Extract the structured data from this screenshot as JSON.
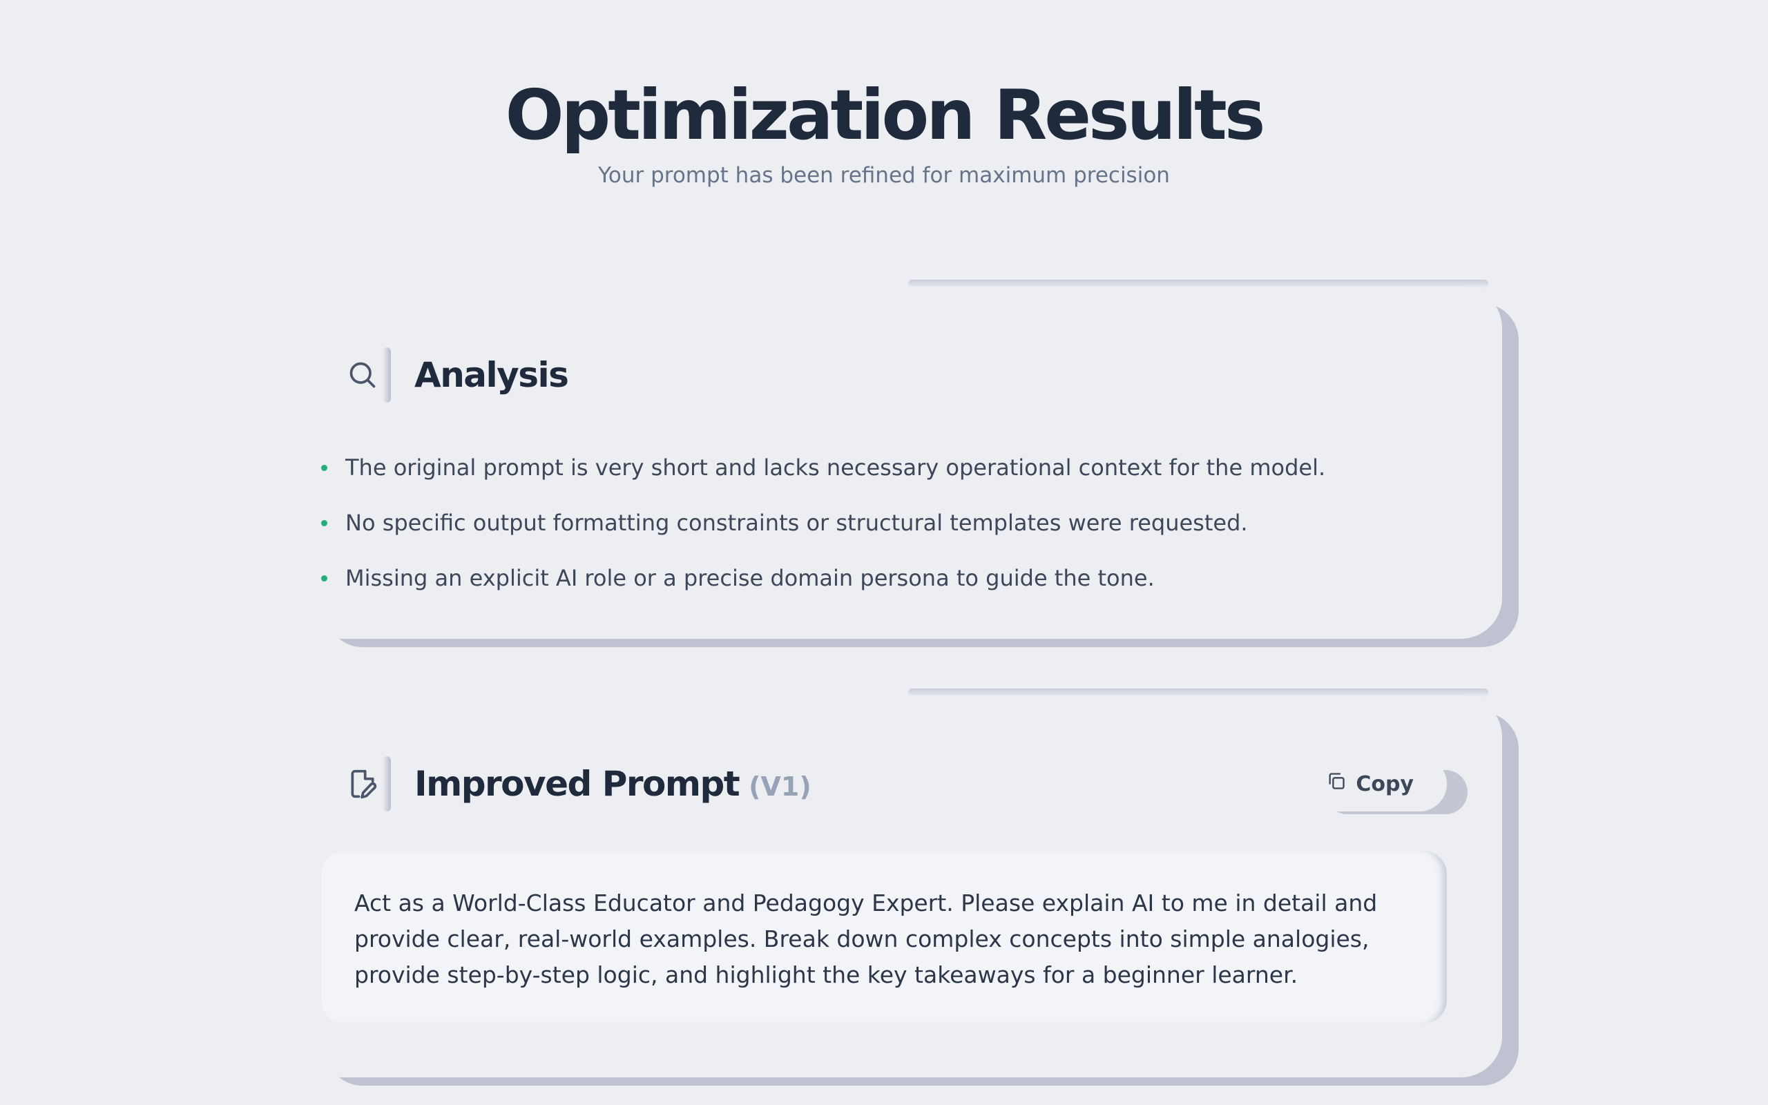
{
  "header": {
    "title": "Optimization Results",
    "subtitle": "Your prompt has been refined for maximum precision"
  },
  "analysis": {
    "icon": "search-icon",
    "title": "Analysis",
    "items": [
      "The original prompt is very short and lacks necessary operational context for the model.",
      "No specific output formatting constraints or structural templates were requested.",
      "Missing an explicit AI role or a precise domain persona to guide the tone."
    ]
  },
  "improved_prompt": {
    "icon": "file-edit-icon",
    "title": "Improved Prompt",
    "version": "(V1)",
    "copy_label": "Copy",
    "text": "Act as a World-Class Educator and Pedagogy Expert. Please explain AI to me in detail and provide clear, real-world examples. Break down complex concepts into simple analogies, provide step-by-step logic, and highlight the key takeaways for a beginner learner."
  },
  "colors": {
    "background": "#eceef2",
    "title": "#1f2a3c",
    "bullet": "#22b07d",
    "muted": "#98a2b6"
  }
}
